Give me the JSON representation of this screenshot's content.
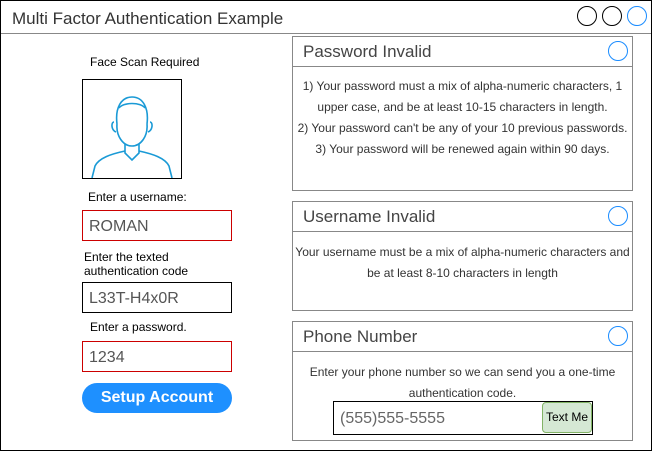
{
  "window": {
    "title": "Multi Factor Authentication Example"
  },
  "left": {
    "face_label": "Face Scan Required",
    "username_label": "Enter a username:",
    "username_value": "ROMAN",
    "code_label_line1": "Enter the texted",
    "code_label_line2": "authentication code",
    "code_value": "L33T-H4x0R",
    "password_label": "Enter a password.",
    "password_value": "1234",
    "setup_button": "Setup Account"
  },
  "panels": {
    "password": {
      "title": "Password Invalid",
      "line1": "1) Your password must a mix of alpha-numeric characters, 1",
      "line2": "upper case, and be at least 10-15 characters in length.",
      "line3": "2) Your password can't be any of your 10 previous passwords.",
      "line4": "3) Your password will be renewed again within 90 days."
    },
    "username": {
      "title": "Username Invalid",
      "line1": "Your username must be a mix of alpha-numeric characters and",
      "line2": "be at least 8-10 characters in length"
    },
    "phone": {
      "title": "Phone Number",
      "line1": "Enter your phone number so we can send you a one-time",
      "line2": "authentication code.",
      "placeholder": "(555)555-5555",
      "button": "Text Me"
    }
  },
  "colors": {
    "accent": "#1e90ff",
    "error_border": "#cc0000",
    "text_me_fill": "#d5e8d4"
  }
}
